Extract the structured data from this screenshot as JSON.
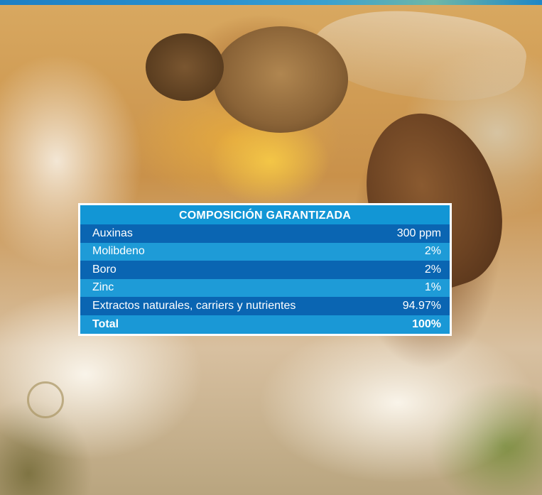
{
  "composition": {
    "title": "COMPOSICIÓN GARANTIZADA",
    "rows": [
      {
        "name": "Auxinas",
        "value": "300 ppm"
      },
      {
        "name": "Molibdeno",
        "value": "2%"
      },
      {
        "name": "Boro",
        "value": "2%"
      },
      {
        "name": "Zinc",
        "value": "1%"
      },
      {
        "name": "Extractos naturales, carriers y nutrientes",
        "value": "94.97%"
      }
    ],
    "total": {
      "name": "Total",
      "value": "100%"
    }
  },
  "colors": {
    "header_blue": "#1296d5",
    "row_dark": "#0a65b2",
    "row_light": "#1e9bd7"
  }
}
